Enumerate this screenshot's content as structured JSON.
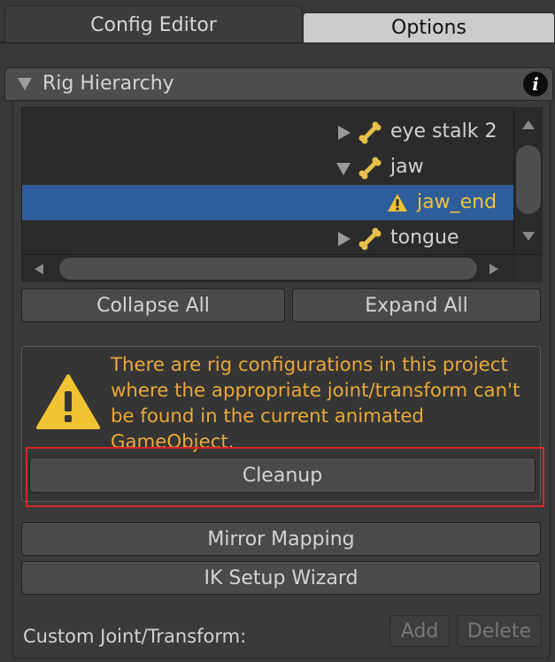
{
  "tabs": [
    {
      "label": "Config Editor",
      "active": true
    },
    {
      "label": "Options",
      "active": false
    }
  ],
  "section": {
    "title": "Rig Hierarchy",
    "info_icon": "i"
  },
  "tree": {
    "rows": [
      {
        "label": "eye stalk 2",
        "expanded": false,
        "icon": "bone-icon",
        "selected": false
      },
      {
        "label": "jaw",
        "expanded": true,
        "icon": "bone-icon",
        "selected": false
      },
      {
        "label": "jaw_end",
        "icon": "warning-icon",
        "selected": true
      },
      {
        "label": "tongue",
        "expanded": false,
        "icon": "bone-icon",
        "selected": false
      }
    ]
  },
  "buttons": {
    "collapse_all": "Collapse All",
    "expand_all": "Expand All",
    "cleanup": "Cleanup",
    "mirror_mapping": "Mirror Mapping",
    "ik_setup_wizard": "IK Setup Wizard",
    "add": "Add",
    "delete": "Delete"
  },
  "warning": {
    "message": "There are rig configurations in this project where the appropriate joint/transform can't be found in the current animated GameObject."
  },
  "custom": {
    "label": "Custom Joint/Transform:"
  },
  "colors": {
    "background": "#383838",
    "selection": "#2e5d9b",
    "warning_text": "#e9a93a",
    "bone_icon": "#e6c04a",
    "highlight_border": "#e02424"
  }
}
